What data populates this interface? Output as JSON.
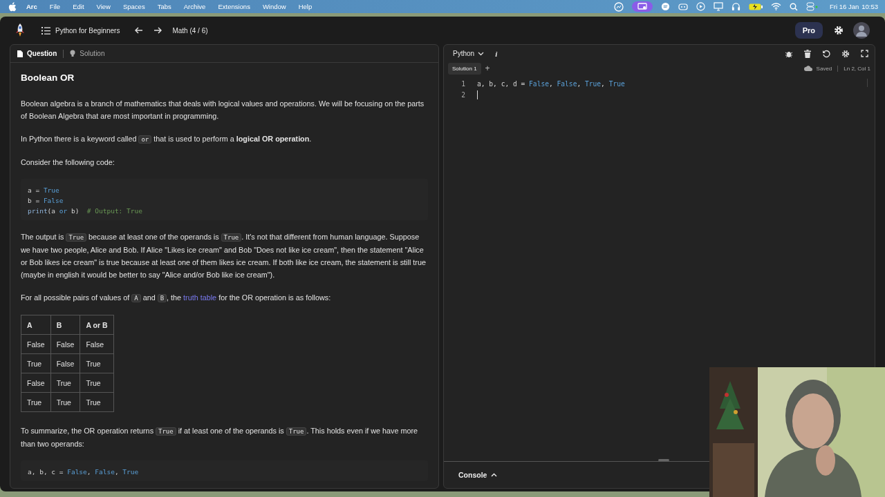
{
  "menu_bar": {
    "app": "Arc",
    "items": [
      "File",
      "Edit",
      "View",
      "Spaces",
      "Tabs",
      "Archive",
      "Extensions",
      "Window",
      "Help"
    ],
    "date": "Fri 16 Jan",
    "time": "10:53"
  },
  "top_bar": {
    "course": "Python for Beginners",
    "lesson": "Math (4 / 6)",
    "plan": "Pro"
  },
  "left_tabs": [
    {
      "label": "Question",
      "selected": true
    },
    {
      "label": "Solution",
      "selected": false
    }
  ],
  "lesson": {
    "title": "Boolean OR",
    "blocks": [
      {
        "kind": "paragraph",
        "parts": [
          {
            "kind": "text",
            "text": "Boolean algebra is a branch of mathematics that deals with logical values and operations. We will be focusing on the parts of Boolean Algebra that are most important in programming."
          }
        ]
      },
      {
        "kind": "paragraph",
        "parts": [
          {
            "kind": "text",
            "text": "In Python there is a keyword called "
          },
          {
            "kind": "code",
            "text": "or"
          },
          {
            "kind": "text",
            "text": " that is used to perform a **logical OR operation**."
          }
        ]
      },
      {
        "kind": "paragraph",
        "parts": [
          {
            "kind": "text",
            "text": "Consider the following code:"
          }
        ]
      },
      {
        "kind": "code",
        "lines": [
          [
            {
              "kind": "plain",
              "text": "a = "
            },
            {
              "kind": "bool",
              "text": "True"
            }
          ],
          [
            {
              "kind": "plain",
              "text": "b = "
            },
            {
              "kind": "bool",
              "text": "False"
            }
          ],
          [
            {
              "kind": "func",
              "text": "print"
            },
            {
              "kind": "plain",
              "text": "(a "
            },
            {
              "kind": "keyword",
              "text": "or"
            },
            {
              "kind": "plain",
              "text": " b)  "
            },
            {
              "kind": "comment",
              "text": "# Output: True"
            }
          ]
        ]
      },
      {
        "kind": "paragraph",
        "parts": [
          {
            "kind": "text",
            "text": "The output is "
          },
          {
            "kind": "code",
            "text": "True"
          },
          {
            "kind": "text",
            "text": " because at least one of the operands is "
          },
          {
            "kind": "code",
            "text": "True"
          },
          {
            "kind": "text",
            "text": ". It's not that different from human language. Suppose we have two people, Alice and Bob. If Alice \"Likes ice cream\" and Bob \"Does not like ice cream\", then the statement \"Alice or Bob likes ice cream\" is true because at least one of them likes ice cream. If both like ice cream, the statement is still true (maybe in english it would be better to say \"Alice and/or Bob like ice cream\")."
          }
        ]
      },
      {
        "kind": "paragraph",
        "parts": [
          {
            "kind": "text",
            "text": "For all possible pairs of values of "
          },
          {
            "kind": "code",
            "text": "A"
          },
          {
            "kind": "text",
            "text": " and "
          },
          {
            "kind": "code",
            "text": "B"
          },
          {
            "kind": "text",
            "text": ", the "
          },
          {
            "kind": "link",
            "text": "truth table"
          },
          {
            "kind": "text",
            "text": " for the OR operation is as follows:"
          }
        ]
      },
      {
        "kind": "table",
        "columns": [
          "A",
          "B",
          "A or B"
        ],
        "rows": [
          [
            "False",
            "False",
            "False"
          ],
          [
            "True",
            "False",
            "True"
          ],
          [
            "False",
            "True",
            "True"
          ],
          [
            "True",
            "True",
            "True"
          ]
        ]
      },
      {
        "kind": "paragraph",
        "parts": [
          {
            "kind": "text",
            "text": "To summarize, the OR operation returns "
          },
          {
            "kind": "code",
            "text": "True"
          },
          {
            "kind": "text",
            "text": " if at least one of the operands is "
          },
          {
            "kind": "code",
            "text": "True"
          },
          {
            "kind": "text",
            "text": ". This holds even if we have more than two operands:"
          }
        ]
      },
      {
        "kind": "code",
        "lines": [
          [
            {
              "kind": "plain",
              "text": "a, b, c = "
            },
            {
              "kind": "bool",
              "text": "False"
            },
            {
              "kind": "plain",
              "text": ", "
            },
            {
              "kind": "bool",
              "text": "False"
            },
            {
              "kind": "plain",
              "text": ", "
            },
            {
              "kind": "bool",
              "text": "True"
            }
          ]
        ]
      }
    ]
  },
  "editor": {
    "language": "Python",
    "info": "i",
    "tabs": [
      {
        "label": "Solution 1",
        "selected": true
      }
    ],
    "add": "+",
    "status": "Saved",
    "position": "Ln 2, Col 1",
    "lines": [
      {
        "number": "1",
        "tokens": [
          {
            "kind": "plain",
            "text": "a, b, c, d = "
          },
          {
            "kind": "bool",
            "text": "False"
          },
          {
            "kind": "plain",
            "text": ", "
          },
          {
            "kind": "bool",
            "text": "False"
          },
          {
            "kind": "plain",
            "text": ", "
          },
          {
            "kind": "bool",
            "text": "True"
          },
          {
            "kind": "plain",
            "text": ", "
          },
          {
            "kind": "bool",
            "text": "True"
          }
        ]
      },
      {
        "number": "2",
        "cursor": true
      }
    ]
  },
  "console": {
    "label": "Console",
    "expanded": false
  }
}
